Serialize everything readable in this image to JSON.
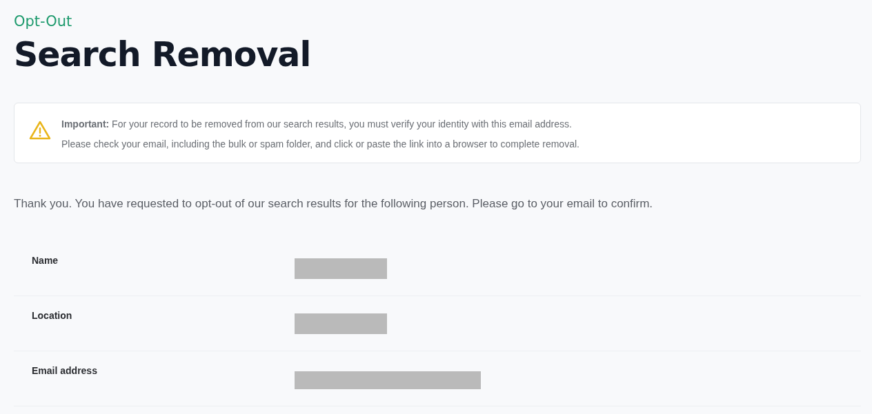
{
  "eyebrow": "Opt-Out",
  "title": "Search Removal",
  "notice": {
    "lines": [
      "**Important:** For your record to be removed from our search results, you must verify your identity with this email address.",
      "Please check your email, including the bulk or spam folder, and click or paste the link into a browser to complete removal."
    ]
  },
  "message": "Thank you. You have requested to opt-out of our search results for the following person. Please go to your email to confirm.",
  "details": [
    {
      "label": "Name",
      "kind": "short"
    },
    {
      "label": "Location",
      "kind": "short"
    },
    {
      "label": "Email address",
      "kind": "long"
    }
  ]
}
